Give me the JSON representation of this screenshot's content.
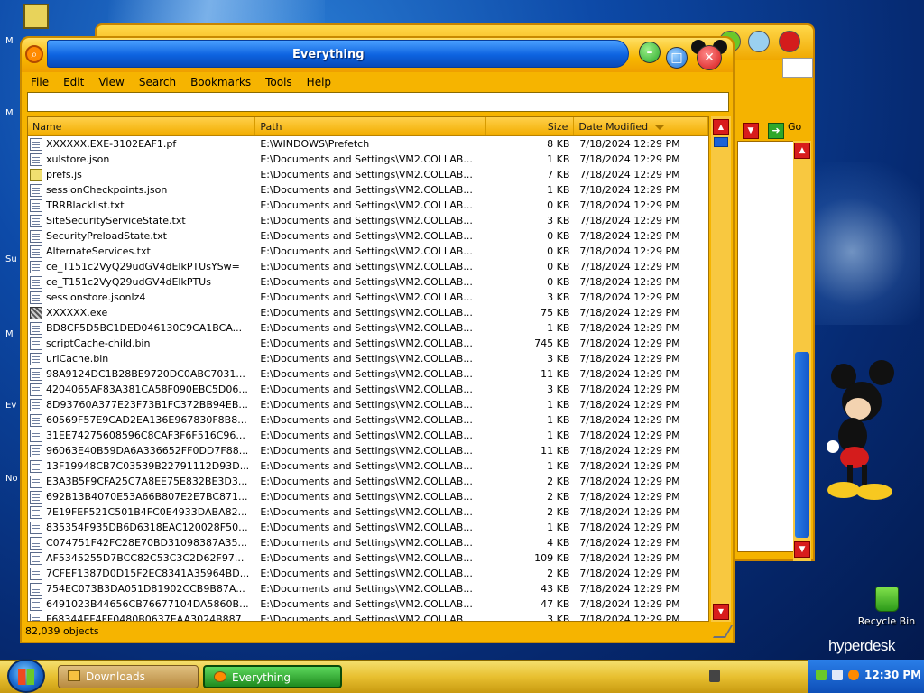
{
  "window": {
    "title": "Everything",
    "menu": [
      "File",
      "Edit",
      "View",
      "Search",
      "Bookmarks",
      "Tools",
      "Help"
    ],
    "search_value": "",
    "columns": {
      "name": "Name",
      "path": "Path",
      "size": "Size",
      "date": "Date Modified"
    },
    "status": "82,039 objects"
  },
  "rows": [
    {
      "name": "XXXXXX.EXE-3102EAF1.pf",
      "path": "E:\\WINDOWS\\Prefetch",
      "size": "8 KB",
      "date": "7/18/2024 12:29 PM",
      "icon": "file"
    },
    {
      "name": "xulstore.json",
      "path": "E:\\Documents and Settings\\VM2.COLLAB...",
      "size": "1 KB",
      "date": "7/18/2024 12:29 PM",
      "icon": "file"
    },
    {
      "name": "prefs.js",
      "path": "E:\\Documents and Settings\\VM2.COLLAB...",
      "size": "7 KB",
      "date": "7/18/2024 12:29 PM",
      "icon": "js"
    },
    {
      "name": "sessionCheckpoints.json",
      "path": "E:\\Documents and Settings\\VM2.COLLAB...",
      "size": "1 KB",
      "date": "7/18/2024 12:29 PM",
      "icon": "file"
    },
    {
      "name": "TRRBlacklist.txt",
      "path": "E:\\Documents and Settings\\VM2.COLLAB...",
      "size": "0 KB",
      "date": "7/18/2024 12:29 PM",
      "icon": "file"
    },
    {
      "name": "SiteSecurityServiceState.txt",
      "path": "E:\\Documents and Settings\\VM2.COLLAB...",
      "size": "3 KB",
      "date": "7/18/2024 12:29 PM",
      "icon": "file"
    },
    {
      "name": "SecurityPreloadState.txt",
      "path": "E:\\Documents and Settings\\VM2.COLLAB...",
      "size": "0 KB",
      "date": "7/18/2024 12:29 PM",
      "icon": "file"
    },
    {
      "name": "AlternateServices.txt",
      "path": "E:\\Documents and Settings\\VM2.COLLAB...",
      "size": "0 KB",
      "date": "7/18/2024 12:29 PM",
      "icon": "file"
    },
    {
      "name": "ce_T151c2VyQ29udGV4dElkPTUsYSw=",
      "path": "E:\\Documents and Settings\\VM2.COLLAB...",
      "size": "0 KB",
      "date": "7/18/2024 12:29 PM",
      "icon": "file"
    },
    {
      "name": "ce_T151c2VyQ29udGV4dElkPTUs",
      "path": "E:\\Documents and Settings\\VM2.COLLAB...",
      "size": "0 KB",
      "date": "7/18/2024 12:29 PM",
      "icon": "file"
    },
    {
      "name": "sessionstore.jsonlz4",
      "path": "E:\\Documents and Settings\\VM2.COLLAB...",
      "size": "3 KB",
      "date": "7/18/2024 12:29 PM",
      "icon": "file"
    },
    {
      "name": "XXXXXX.exe",
      "path": "E:\\Documents and Settings\\VM2.COLLAB...",
      "size": "75 KB",
      "date": "7/18/2024 12:29 PM",
      "icon": "exe"
    },
    {
      "name": "BD8CF5D5BC1DED046130C9CA1BCA...",
      "path": "E:\\Documents and Settings\\VM2.COLLAB...",
      "size": "1 KB",
      "date": "7/18/2024 12:29 PM",
      "icon": "file"
    },
    {
      "name": "scriptCache-child.bin",
      "path": "E:\\Documents and Settings\\VM2.COLLAB...",
      "size": "745 KB",
      "date": "7/18/2024 12:29 PM",
      "icon": "file"
    },
    {
      "name": "urlCache.bin",
      "path": "E:\\Documents and Settings\\VM2.COLLAB...",
      "size": "3 KB",
      "date": "7/18/2024 12:29 PM",
      "icon": "file"
    },
    {
      "name": "98A9124DC1B28BE9720DC0ABC7031...",
      "path": "E:\\Documents and Settings\\VM2.COLLAB...",
      "size": "11 KB",
      "date": "7/18/2024 12:29 PM",
      "icon": "file"
    },
    {
      "name": "4204065AF83A381CA58F090EBC5D06...",
      "path": "E:\\Documents and Settings\\VM2.COLLAB...",
      "size": "3 KB",
      "date": "7/18/2024 12:29 PM",
      "icon": "file"
    },
    {
      "name": "8D93760A377E23F73B1FC372BB94EB...",
      "path": "E:\\Documents and Settings\\VM2.COLLAB...",
      "size": "1 KB",
      "date": "7/18/2024 12:29 PM",
      "icon": "file"
    },
    {
      "name": "60569F57E9CAD2EA136E967830F8B8...",
      "path": "E:\\Documents and Settings\\VM2.COLLAB...",
      "size": "1 KB",
      "date": "7/18/2024 12:29 PM",
      "icon": "file"
    },
    {
      "name": "31EE74275608596C8CAF3F6F516C96...",
      "path": "E:\\Documents and Settings\\VM2.COLLAB...",
      "size": "1 KB",
      "date": "7/18/2024 12:29 PM",
      "icon": "file"
    },
    {
      "name": "96063E40B59DA6A336652FF0DD7F88...",
      "path": "E:\\Documents and Settings\\VM2.COLLAB...",
      "size": "11 KB",
      "date": "7/18/2024 12:29 PM",
      "icon": "file"
    },
    {
      "name": "13F19948CB7C03539B22791112D93D...",
      "path": "E:\\Documents and Settings\\VM2.COLLAB...",
      "size": "1 KB",
      "date": "7/18/2024 12:29 PM",
      "icon": "file"
    },
    {
      "name": "E3A3B5F9CFA25C7A8EE75E832BE3D3...",
      "path": "E:\\Documents and Settings\\VM2.COLLAB...",
      "size": "2 KB",
      "date": "7/18/2024 12:29 PM",
      "icon": "file"
    },
    {
      "name": "692B13B4070E53A66B807E2E7BC871...",
      "path": "E:\\Documents and Settings\\VM2.COLLAB...",
      "size": "2 KB",
      "date": "7/18/2024 12:29 PM",
      "icon": "file"
    },
    {
      "name": "7E19FEF521C501B4FC0E4933DABA82...",
      "path": "E:\\Documents and Settings\\VM2.COLLAB...",
      "size": "2 KB",
      "date": "7/18/2024 12:29 PM",
      "icon": "file"
    },
    {
      "name": "835354F935DB6D6318EAC120028F50...",
      "path": "E:\\Documents and Settings\\VM2.COLLAB...",
      "size": "1 KB",
      "date": "7/18/2024 12:29 PM",
      "icon": "file"
    },
    {
      "name": "C074751F42FC28E70BD31098387A35...",
      "path": "E:\\Documents and Settings\\VM2.COLLAB...",
      "size": "4 KB",
      "date": "7/18/2024 12:29 PM",
      "icon": "file"
    },
    {
      "name": "AF5345255D7BCC82C53C3C2D62F97...",
      "path": "E:\\Documents and Settings\\VM2.COLLAB...",
      "size": "109 KB",
      "date": "7/18/2024 12:29 PM",
      "icon": "file"
    },
    {
      "name": "7CFEF1387D0D15F2EC8341A35964BD...",
      "path": "E:\\Documents and Settings\\VM2.COLLAB...",
      "size": "2 KB",
      "date": "7/18/2024 12:29 PM",
      "icon": "file"
    },
    {
      "name": "754EC073B3DA051D81902CCB9B87A...",
      "path": "E:\\Documents and Settings\\VM2.COLLAB...",
      "size": "43 KB",
      "date": "7/18/2024 12:29 PM",
      "icon": "file"
    },
    {
      "name": "6491023B44656CB76677104DA5860B...",
      "path": "E:\\Documents and Settings\\VM2.COLLAB...",
      "size": "47 KB",
      "date": "7/18/2024 12:29 PM",
      "icon": "file"
    },
    {
      "name": "F68344EF4FF0480B0637EAA3024B887...",
      "path": "E:\\Documents and Settings\\VM2.COLLAB...",
      "size": "3 KB",
      "date": "7/18/2024 12:29 PM",
      "icon": "file"
    }
  ],
  "background_window": {
    "go_label": "Go"
  },
  "desktop": {
    "recycle_bin": "Recycle Bin",
    "brand": "hyperdesk"
  },
  "taskbar": {
    "items": [
      "Downloads",
      "Everything"
    ],
    "clock": "12:30 PM"
  },
  "colors": {
    "window_frame": "#f6b400",
    "titlebar_blue": "#0d63e0",
    "close_red": "#d41414",
    "minimize_green": "#2aa82a"
  }
}
